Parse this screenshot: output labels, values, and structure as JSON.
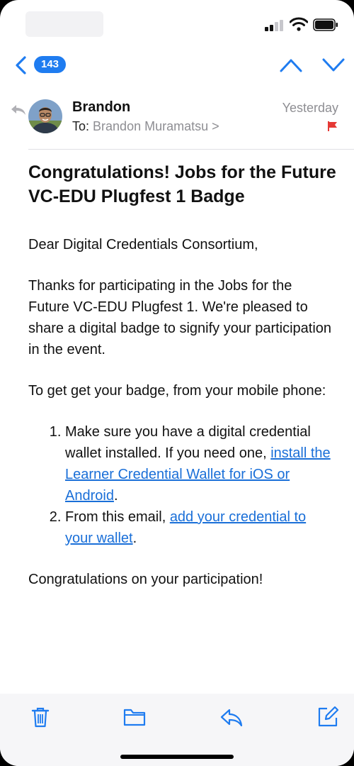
{
  "nav": {
    "unread_count": "143"
  },
  "message": {
    "sender": "Brandon",
    "to_label": "To:",
    "recipient": "Brandon Muramatsu",
    "recipient_chevron": ">",
    "date": "Yesterday",
    "subject": "Congratulations! Jobs for the Future VC-EDU Plugfest 1 Badge",
    "body": {
      "greeting": "Dear Digital Credentials Consortium,",
      "para1": "Thanks for participating in the Jobs for the Future VC-EDU Plugfest 1. We're pleased to share a digital badge to signify your participation in the event.",
      "para2": "To get get your badge, from your mobile phone:",
      "step1_text": "Make sure you have a digital credential wallet installed. If you need one, ",
      "step1_link": "install the Learner Credential Wallet for iOS or Android",
      "step1_end": ".",
      "step2_text": "From this email, ",
      "step2_link": "add your credential to your wallet",
      "step2_end": ".",
      "closing": "Congratulations on your participation!"
    }
  },
  "colors": {
    "accent": "#1f7cf0",
    "link": "#1a6fd8",
    "flag": "#e53935",
    "secondary_text": "#8e8e93"
  },
  "icons": {
    "status": [
      "signal-icon",
      "wifi-icon",
      "battery-icon"
    ],
    "nav": [
      "back-chevron-icon",
      "chevron-up-icon",
      "chevron-down-icon"
    ],
    "toolbar": [
      "trash-icon",
      "folder-icon",
      "reply-icon",
      "compose-icon"
    ]
  }
}
